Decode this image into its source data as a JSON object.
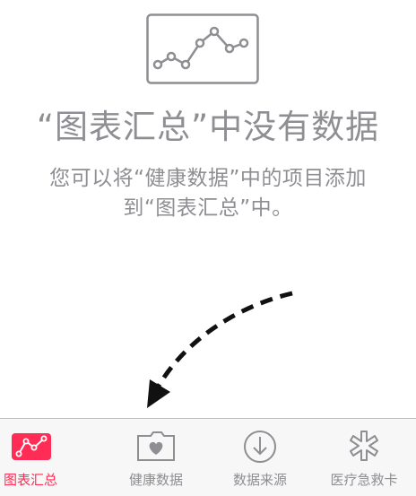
{
  "empty_state": {
    "title": "“图表汇总”中没有数据",
    "description_line1": "您可以将“健康数据”中的项目添加",
    "description_line2": "到“图表汇总”中。"
  },
  "tabs": [
    {
      "label": "图表汇总",
      "icon": "chart-line-icon",
      "active": true
    },
    {
      "label": "健康数据",
      "icon": "heart-folder-icon",
      "active": false
    },
    {
      "label": "数据来源",
      "icon": "download-arrow-icon",
      "active": false
    },
    {
      "label": "医疗急救卡",
      "icon": "medical-star-icon",
      "active": false
    }
  ],
  "colors": {
    "accent": "#ff2d55",
    "inactive": "#8e8e93",
    "tab_bar_bg": "#f7f7f7"
  }
}
